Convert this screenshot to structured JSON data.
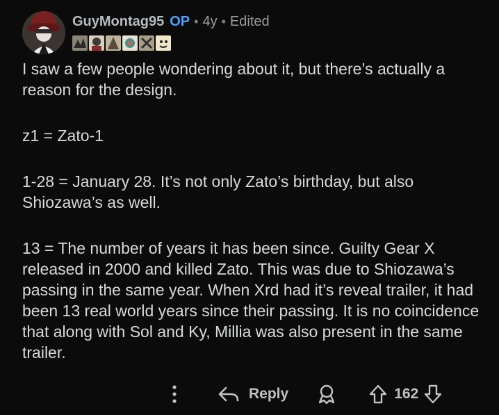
{
  "comment": {
    "author": "GuyMontag95",
    "op_badge": "OP",
    "separator": "•",
    "age": "4y",
    "edited": "Edited",
    "flair_icons": [
      "flair-icon-1",
      "flair-icon-2",
      "flair-icon-3",
      "flair-icon-4",
      "flair-icon-5",
      "flair-icon-6"
    ],
    "paragraphs": [
      "I saw a few people wondering about it, but there’s actually a reason for the design.",
      "z1 = Zato-1",
      "1-28 = January 28. It’s not only Zato’s birthday, but also Shiozawa’s as well.",
      "13 = The number of years it has been since. Guilty Gear X released in 2000 and killed Zato. This was due to Shiozawa’s passing in the same year. When Xrd had it’s reveal trailer, it had been 13 real world years since their passing. It is no coincidence that along with Sol and Ky, Millia was also present in the same trailer."
    ]
  },
  "actions": {
    "more_icon": "more-vertical-icon",
    "reply_icon": "reply-arrow-icon",
    "reply_label": "Reply",
    "award_icon": "award-icon",
    "upvote_icon": "upvote-arrow-icon",
    "score": "162",
    "downvote_icon": "downvote-arrow-icon"
  },
  "colors": {
    "background": "#0b0b0c",
    "text": "#d7dadc",
    "username": "#b8bcbf",
    "op_badge": "#4aa3ff",
    "meta": "#9a9d9f",
    "icon": "#c0c3c5"
  }
}
